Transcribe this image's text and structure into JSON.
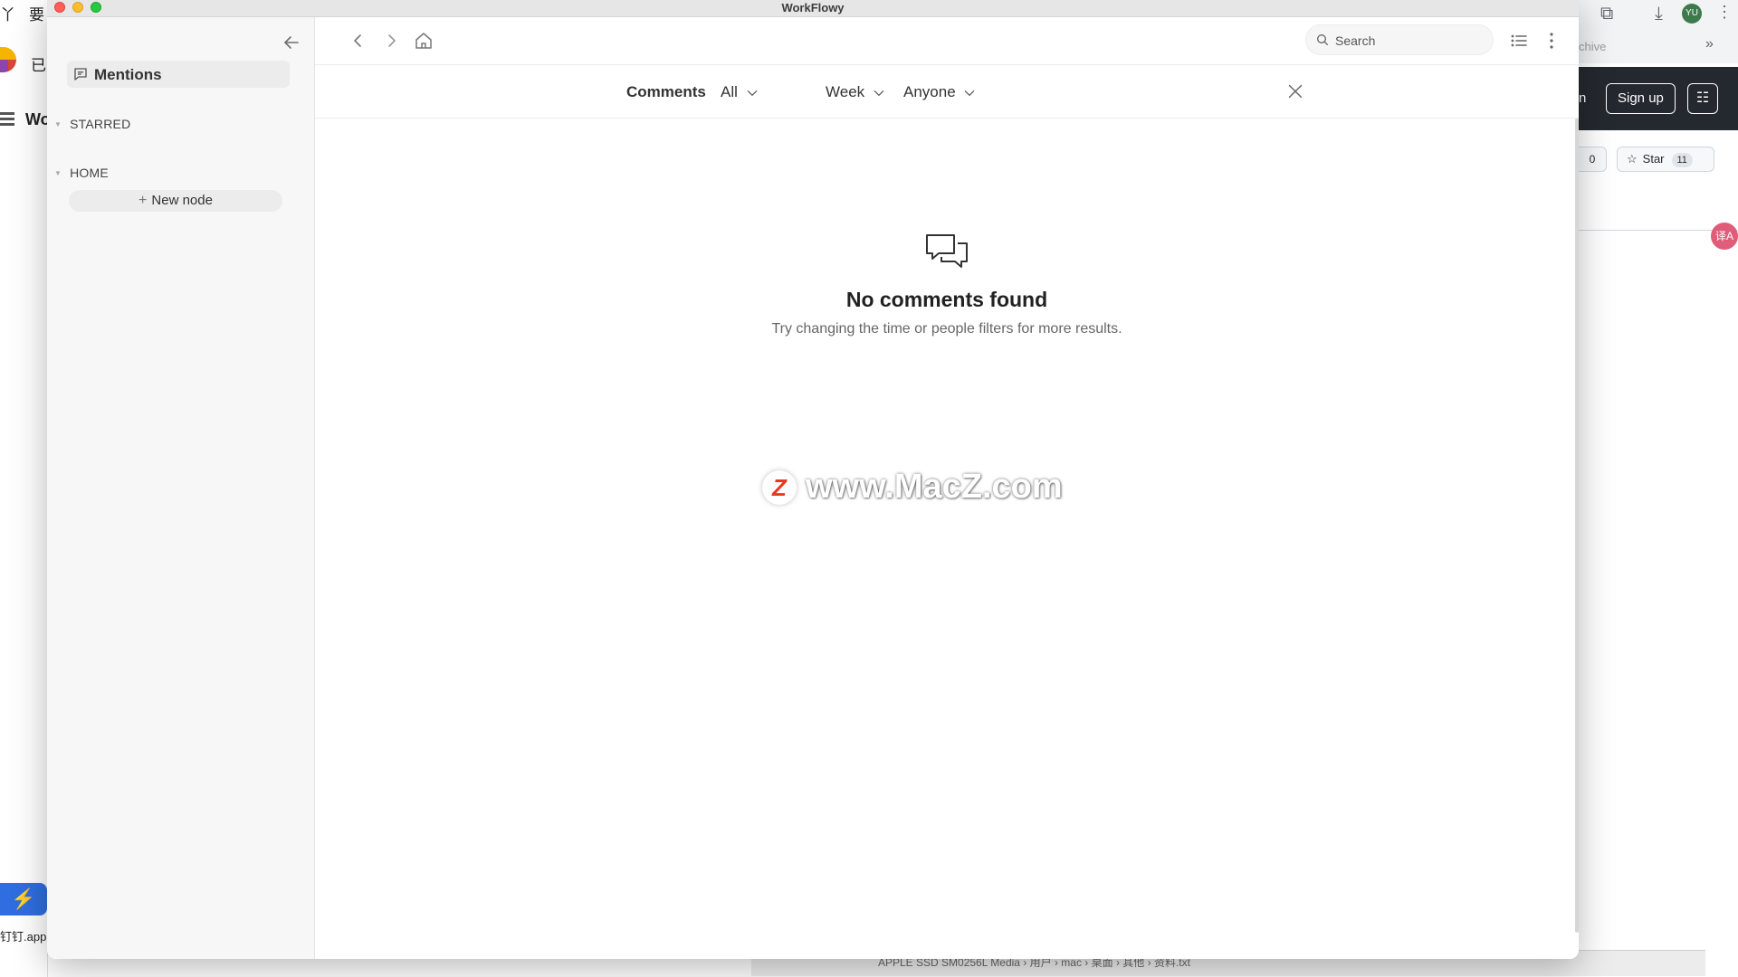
{
  "window": {
    "title": "WorkFlowy"
  },
  "background": {
    "left": {
      "text1": "丫",
      "text2": "要",
      "text3": "已",
      "text4": "Wo",
      "dock_label": "钉钉.app"
    },
    "right": {
      "archive": "chive",
      "profile": "YU",
      "partial_letter": "n",
      "signup": "Sign up",
      "count": "0",
      "star_label": "Star",
      "star_count": "11",
      "translate": "译A"
    },
    "finder_path": "APPLE SSD SM0256L Media › 用户 › mac › 桌面 › 其他 › 资料.txt"
  },
  "sidebar": {
    "mentions_label": "Mentions",
    "sections": [
      {
        "label": "STARRED"
      },
      {
        "label": "HOME"
      }
    ],
    "new_node_label": "New node"
  },
  "toolbar": {
    "search_placeholder": "Search"
  },
  "filters": {
    "title": "Comments",
    "scope": "All",
    "period": "Week",
    "person": "Anyone"
  },
  "empty_state": {
    "title": "No comments found",
    "subtitle": "Try changing the time or people filters for more results."
  },
  "watermark": {
    "logo": "Z",
    "text": "www.MacZ.com"
  },
  "colors": {
    "close_red": "#ff5f57",
    "minimize_yellow": "#febc2e",
    "zoom_green": "#28c840",
    "sidebar_bg": "#f7f7f7",
    "github_dark": "#24292f"
  }
}
